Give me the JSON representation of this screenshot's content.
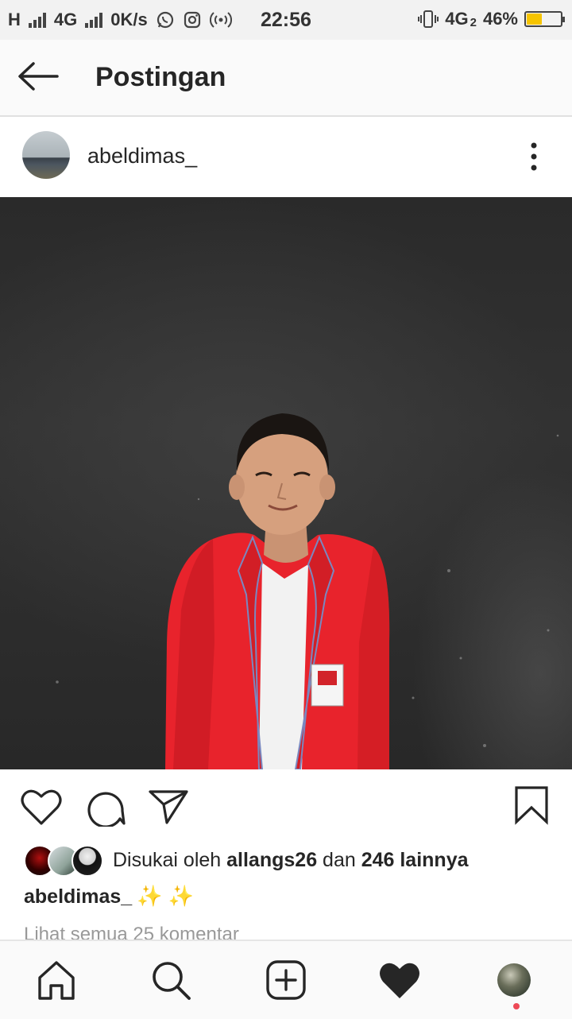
{
  "status_bar": {
    "network_h": "H",
    "network_4g": "4G",
    "speed": "0K/s",
    "time": "22:56",
    "network_4g2": "4G",
    "battery_text": "46%",
    "battery_level": 0.46,
    "battery_color": "#f6c400"
  },
  "header": {
    "title": "Postingan",
    "back_icon": "arrow-left-icon"
  },
  "post": {
    "username": "abeldimas_",
    "more_icon": "more-vertical-icon"
  },
  "actions": {
    "icons": [
      "heart-icon",
      "comment-icon",
      "share-icon",
      "bookmark-icon"
    ]
  },
  "likes": {
    "prefix": "Disukai oleh ",
    "liker": "allangs26",
    "middle": " dan ",
    "others": "246 lainnya"
  },
  "caption": {
    "username": "abeldimas_",
    "text": "✨ ✨"
  },
  "comments": {
    "link_text": "Lihat semua 25 komentar"
  },
  "bottom_nav": {
    "items": [
      "home-icon",
      "search-icon",
      "add-post-icon",
      "activity-heart-icon",
      "profile-avatar"
    ],
    "notification_color": "#ed4956"
  }
}
